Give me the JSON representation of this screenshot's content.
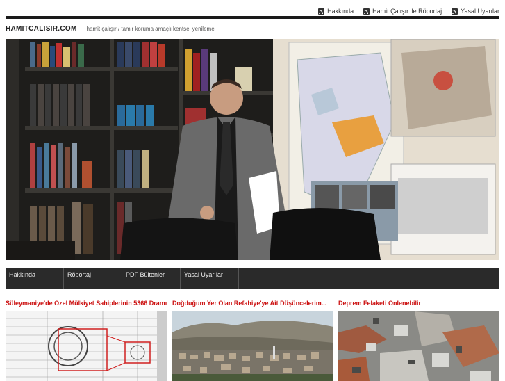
{
  "topnav": [
    {
      "label": "Hakkında",
      "icon": "rss-icon"
    },
    {
      "label": "Hamit Çalışır ile Röportaj",
      "icon": "rss-icon"
    },
    {
      "label": "Yasal Uyarılar",
      "icon": "rss-icon"
    }
  ],
  "site": {
    "name": "HAMITCALISIR.COM",
    "tagline": "hamit çalışır / tamir koruma amaçlı kentsel yenileme"
  },
  "nav": [
    {
      "label": "Hakkında"
    },
    {
      "label": "Röportaj"
    },
    {
      "label": "PDF Bültenler"
    },
    {
      "label": "Yasal Uyarılar"
    }
  ],
  "articles": [
    {
      "title": "Süleymaniye'de Özel Mülkiyet Sahiplerinin 5366 Dramı"
    },
    {
      "title": "Doğduğum Yer Olan Refahiye'ye Ait Düşüncelerim..."
    },
    {
      "title": "Deprem Felaketi Önlenebilir"
    }
  ],
  "colors": {
    "accent": "#cc1111",
    "nav_bg": "#2a2a2a",
    "rule": "#1a1a1a"
  }
}
